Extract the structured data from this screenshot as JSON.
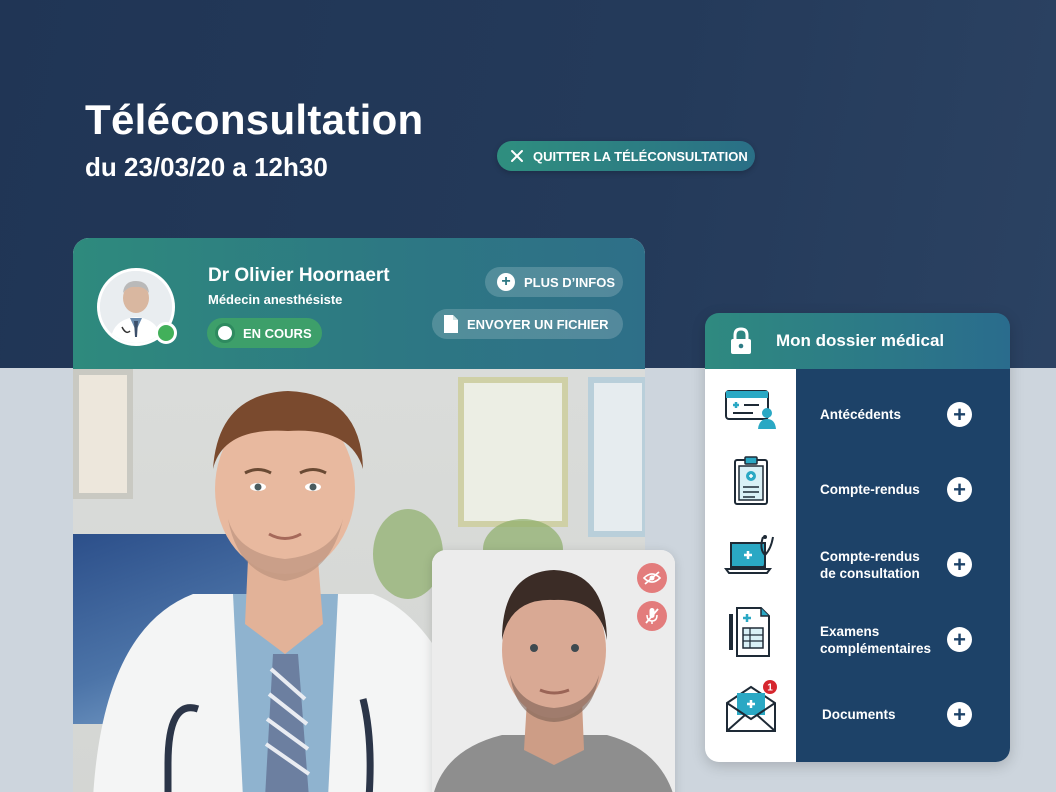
{
  "page": {
    "title": "Téléconsultation",
    "subtitle": "du 23/03/20 a 12h30",
    "quit_label": "QUITTER LA TÉLÉCONSULTATION"
  },
  "doctor": {
    "name": "Dr Olivier Hoornaert",
    "role": "Médecin anesthésiste",
    "status_label": "EN COURS",
    "more_info_label": "PLUS D’INFOS",
    "send_file_label": "ENVOYER UN FICHIER"
  },
  "dossier": {
    "title": "Mon dossier médical",
    "items": [
      {
        "label": "Antécédents",
        "icon": "medical-card-icon"
      },
      {
        "label": "Compte-rendus",
        "icon": "clipboard-icon"
      },
      {
        "label": "Compte-rendus\nde consultation",
        "icon": "laptop-stethoscope-icon"
      },
      {
        "label": "Examens\ncomplémentaires",
        "icon": "lab-report-icon"
      },
      {
        "label": "Documents",
        "icon": "envelope-icon",
        "badge": "1"
      }
    ]
  },
  "colors": {
    "dark_navy": "#203555",
    "teal": "#2e8a7d",
    "list_bg": "#1d4268",
    "status_green": "#42b05a",
    "control_red": "#e37c7c"
  }
}
